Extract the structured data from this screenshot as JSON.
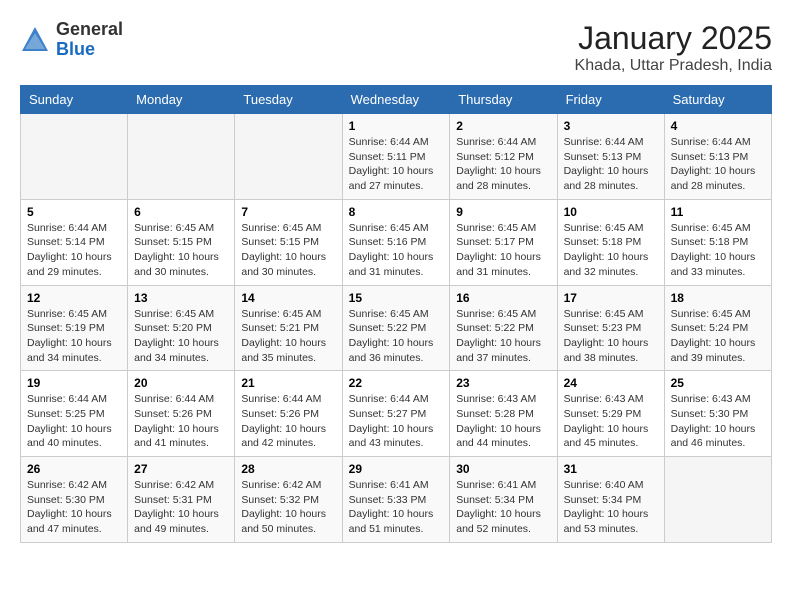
{
  "header": {
    "logo_general": "General",
    "logo_blue": "Blue",
    "title": "January 2025",
    "subtitle": "Khada, Uttar Pradesh, India"
  },
  "weekdays": [
    "Sunday",
    "Monday",
    "Tuesday",
    "Wednesday",
    "Thursday",
    "Friday",
    "Saturday"
  ],
  "weeks": [
    [
      {
        "day": "",
        "info": ""
      },
      {
        "day": "",
        "info": ""
      },
      {
        "day": "",
        "info": ""
      },
      {
        "day": "1",
        "info": "Sunrise: 6:44 AM\nSunset: 5:11 PM\nDaylight: 10 hours and 27 minutes."
      },
      {
        "day": "2",
        "info": "Sunrise: 6:44 AM\nSunset: 5:12 PM\nDaylight: 10 hours and 28 minutes."
      },
      {
        "day": "3",
        "info": "Sunrise: 6:44 AM\nSunset: 5:13 PM\nDaylight: 10 hours and 28 minutes."
      },
      {
        "day": "4",
        "info": "Sunrise: 6:44 AM\nSunset: 5:13 PM\nDaylight: 10 hours and 28 minutes."
      }
    ],
    [
      {
        "day": "5",
        "info": "Sunrise: 6:44 AM\nSunset: 5:14 PM\nDaylight: 10 hours and 29 minutes."
      },
      {
        "day": "6",
        "info": "Sunrise: 6:45 AM\nSunset: 5:15 PM\nDaylight: 10 hours and 30 minutes."
      },
      {
        "day": "7",
        "info": "Sunrise: 6:45 AM\nSunset: 5:15 PM\nDaylight: 10 hours and 30 minutes."
      },
      {
        "day": "8",
        "info": "Sunrise: 6:45 AM\nSunset: 5:16 PM\nDaylight: 10 hours and 31 minutes."
      },
      {
        "day": "9",
        "info": "Sunrise: 6:45 AM\nSunset: 5:17 PM\nDaylight: 10 hours and 31 minutes."
      },
      {
        "day": "10",
        "info": "Sunrise: 6:45 AM\nSunset: 5:18 PM\nDaylight: 10 hours and 32 minutes."
      },
      {
        "day": "11",
        "info": "Sunrise: 6:45 AM\nSunset: 5:18 PM\nDaylight: 10 hours and 33 minutes."
      }
    ],
    [
      {
        "day": "12",
        "info": "Sunrise: 6:45 AM\nSunset: 5:19 PM\nDaylight: 10 hours and 34 minutes."
      },
      {
        "day": "13",
        "info": "Sunrise: 6:45 AM\nSunset: 5:20 PM\nDaylight: 10 hours and 34 minutes."
      },
      {
        "day": "14",
        "info": "Sunrise: 6:45 AM\nSunset: 5:21 PM\nDaylight: 10 hours and 35 minutes."
      },
      {
        "day": "15",
        "info": "Sunrise: 6:45 AM\nSunset: 5:22 PM\nDaylight: 10 hours and 36 minutes."
      },
      {
        "day": "16",
        "info": "Sunrise: 6:45 AM\nSunset: 5:22 PM\nDaylight: 10 hours and 37 minutes."
      },
      {
        "day": "17",
        "info": "Sunrise: 6:45 AM\nSunset: 5:23 PM\nDaylight: 10 hours and 38 minutes."
      },
      {
        "day": "18",
        "info": "Sunrise: 6:45 AM\nSunset: 5:24 PM\nDaylight: 10 hours and 39 minutes."
      }
    ],
    [
      {
        "day": "19",
        "info": "Sunrise: 6:44 AM\nSunset: 5:25 PM\nDaylight: 10 hours and 40 minutes."
      },
      {
        "day": "20",
        "info": "Sunrise: 6:44 AM\nSunset: 5:26 PM\nDaylight: 10 hours and 41 minutes."
      },
      {
        "day": "21",
        "info": "Sunrise: 6:44 AM\nSunset: 5:26 PM\nDaylight: 10 hours and 42 minutes."
      },
      {
        "day": "22",
        "info": "Sunrise: 6:44 AM\nSunset: 5:27 PM\nDaylight: 10 hours and 43 minutes."
      },
      {
        "day": "23",
        "info": "Sunrise: 6:43 AM\nSunset: 5:28 PM\nDaylight: 10 hours and 44 minutes."
      },
      {
        "day": "24",
        "info": "Sunrise: 6:43 AM\nSunset: 5:29 PM\nDaylight: 10 hours and 45 minutes."
      },
      {
        "day": "25",
        "info": "Sunrise: 6:43 AM\nSunset: 5:30 PM\nDaylight: 10 hours and 46 minutes."
      }
    ],
    [
      {
        "day": "26",
        "info": "Sunrise: 6:42 AM\nSunset: 5:30 PM\nDaylight: 10 hours and 47 minutes."
      },
      {
        "day": "27",
        "info": "Sunrise: 6:42 AM\nSunset: 5:31 PM\nDaylight: 10 hours and 49 minutes."
      },
      {
        "day": "28",
        "info": "Sunrise: 6:42 AM\nSunset: 5:32 PM\nDaylight: 10 hours and 50 minutes."
      },
      {
        "day": "29",
        "info": "Sunrise: 6:41 AM\nSunset: 5:33 PM\nDaylight: 10 hours and 51 minutes."
      },
      {
        "day": "30",
        "info": "Sunrise: 6:41 AM\nSunset: 5:34 PM\nDaylight: 10 hours and 52 minutes."
      },
      {
        "day": "31",
        "info": "Sunrise: 6:40 AM\nSunset: 5:34 PM\nDaylight: 10 hours and 53 minutes."
      },
      {
        "day": "",
        "info": ""
      }
    ]
  ]
}
